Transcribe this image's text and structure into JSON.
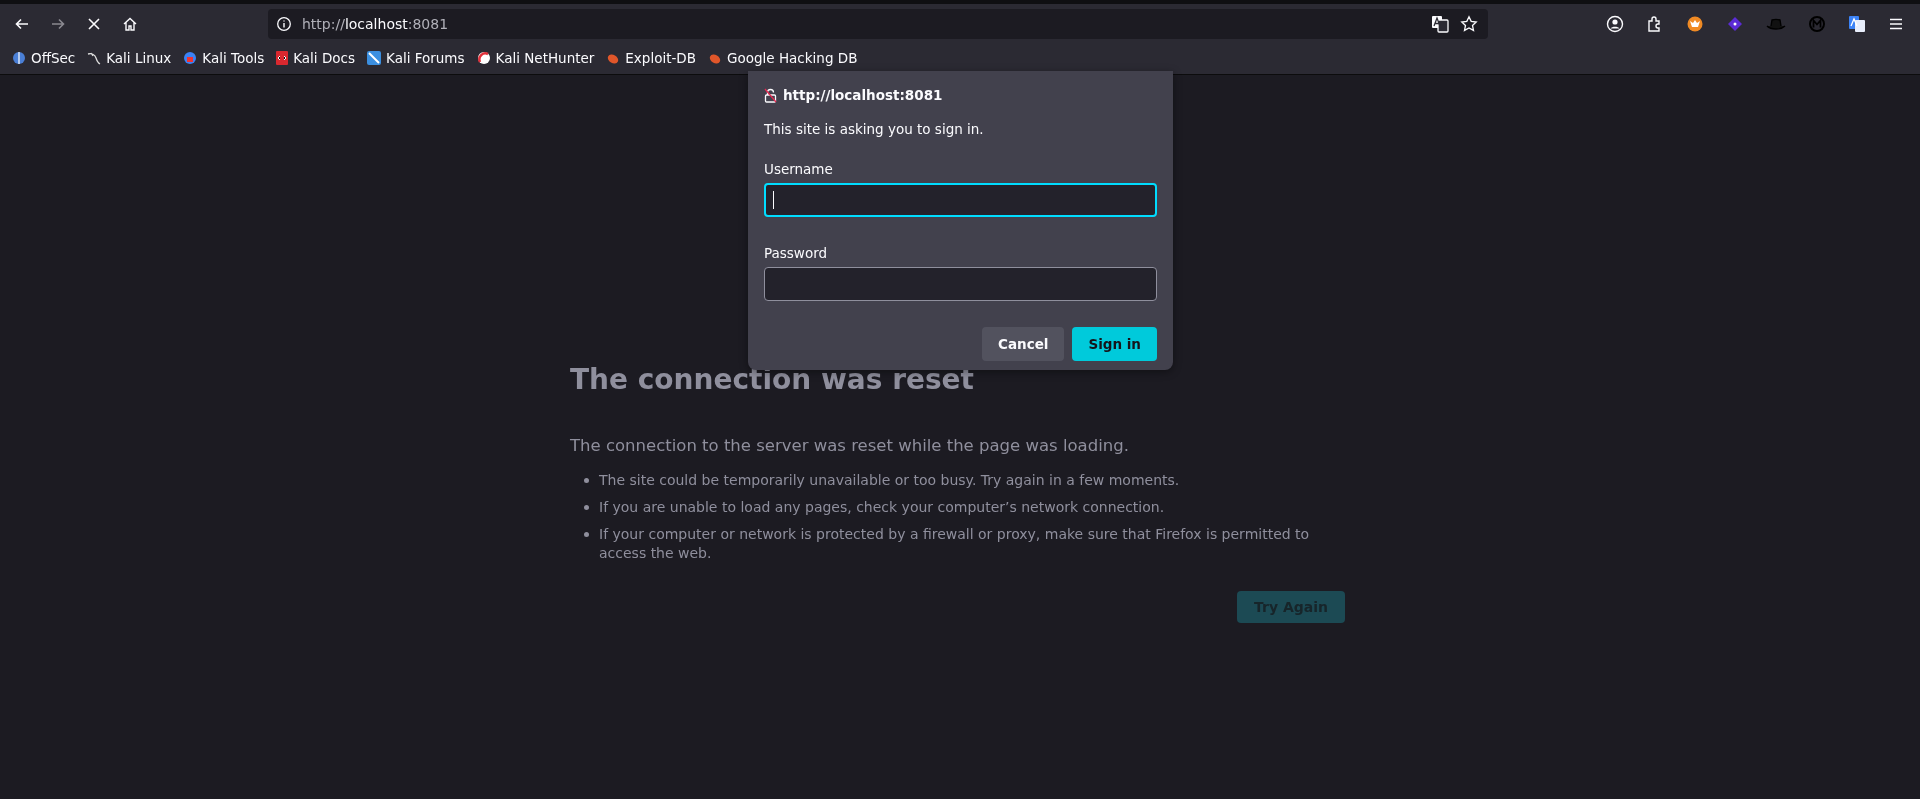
{
  "toolbar": {
    "forward_disabled": true,
    "loading": true,
    "url": {
      "scheme": "http://",
      "host": "localhost",
      "port": ":8081"
    }
  },
  "bookmarks": [
    {
      "label": "OffSec"
    },
    {
      "label": "Kali Linux"
    },
    {
      "label": "Kali Tools"
    },
    {
      "label": "Kali Docs"
    },
    {
      "label": "Kali Forums"
    },
    {
      "label": "Kali NetHunter"
    },
    {
      "label": "Exploit-DB"
    },
    {
      "label": "Google Hacking DB"
    }
  ],
  "dialog": {
    "origin": "http://localhost:8081",
    "message": "This site is asking you to sign in.",
    "fields": [
      {
        "label": "Username",
        "focused": true
      },
      {
        "label": "Password",
        "focused": false
      }
    ],
    "buttons": [
      {
        "label": "Cancel",
        "kind": "secondary"
      },
      {
        "label": "Sign in",
        "kind": "primary"
      }
    ]
  },
  "page": {
    "title": "The connection was reset",
    "intro": "The connection to the server was reset while the page was loading.",
    "bullets": [
      "The site could be temporarily unavailable or too busy. Try again in a few moments.",
      "If you are unable to load any pages, check your computer’s network connection.",
      "If your computer or network is protected by a firewall or proxy, make sure that Firefox is permitted to access the web."
    ],
    "button": "Try Again"
  }
}
